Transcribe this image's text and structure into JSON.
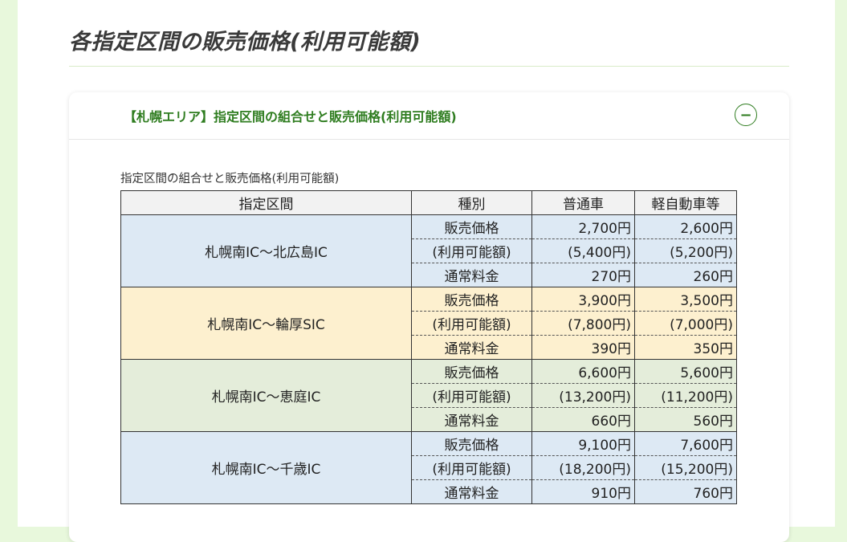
{
  "page": {
    "section_title": "各指定区間の販売価格(利用可能額)"
  },
  "card": {
    "header_title": "【札幌エリア】指定区間の組合せと販売価格(利用可能額)",
    "toggle_symbol": "−",
    "caption": "指定区間の組合せと販売価格(利用可能額)"
  },
  "table": {
    "headers": [
      "指定区間",
      "種別",
      "普通車",
      "軽自動車等"
    ],
    "row_types": [
      "販売価格",
      "(利用可能額)",
      "通常料金"
    ],
    "sections": [
      {
        "name": "札幌南IC〜北広島IC",
        "color": "#dde9f4",
        "rows": [
          [
            "2,700円",
            "2,600円"
          ],
          [
            "(5,400円)",
            "(5,200円)"
          ],
          [
            "270円",
            "260円"
          ]
        ]
      },
      {
        "name": "札幌南IC〜輪厚SIC",
        "color": "#fdf0cf",
        "rows": [
          [
            "3,900円",
            "3,500円"
          ],
          [
            "(7,800円)",
            "(7,000円)"
          ],
          [
            "390円",
            "350円"
          ]
        ]
      },
      {
        "name": "札幌南IC〜恵庭IC",
        "color": "#e4edda",
        "rows": [
          [
            "6,600円",
            "5,600円"
          ],
          [
            "(13,200円)",
            "(11,200円)"
          ],
          [
            "660円",
            "560円"
          ]
        ]
      },
      {
        "name": "札幌南IC〜千歳IC",
        "color": "#dde9f4",
        "rows": [
          [
            "9,100円",
            "7,600円"
          ],
          [
            "(18,200円)",
            "(15,200円)"
          ],
          [
            "910円",
            "760円"
          ]
        ]
      }
    ]
  },
  "colors": {
    "accent_green": "#2f7d20",
    "page_background": "#e8f8dc"
  }
}
